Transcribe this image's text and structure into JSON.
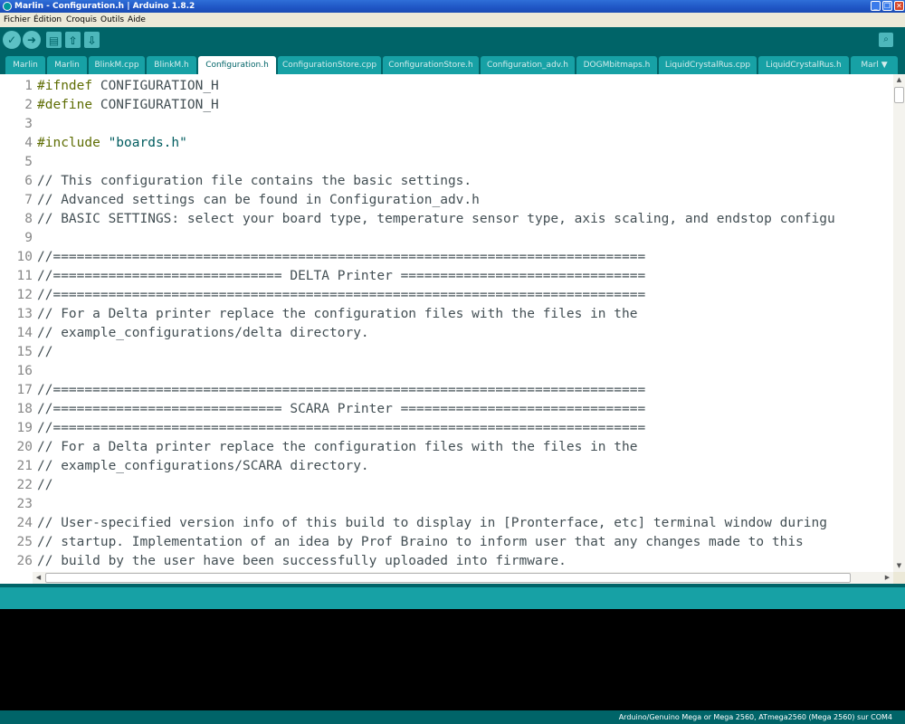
{
  "window": {
    "title": "Marlin - Configuration.h | Arduino 1.8.2",
    "minimize_glyph": "_",
    "maximize_glyph": "❐",
    "close_glyph": "✕"
  },
  "menu": [
    "Fichier",
    "Édition",
    "Croquis",
    "Outils",
    "Aide"
  ],
  "toolbar": {
    "verify_glyph": "✓",
    "upload_glyph": "➜",
    "new_glyph": "▤",
    "open_glyph": "⇧",
    "save_glyph": "⇩",
    "serial_glyph": "⌕"
  },
  "tabs": [
    "Marlin",
    "Marlin",
    "BlinkM.cpp",
    "BlinkM.h",
    "Configuration.h",
    "ConfigurationStore.cpp",
    "ConfigurationStore.h",
    "Configuration_adv.h",
    "DOGMbitmaps.h",
    "LiquidCrystalRus.cpp",
    "LiquidCrystalRus.h",
    "Marl ▼"
  ],
  "active_tab": "Configuration.h",
  "line_numbers": [
    "1",
    "2",
    "3",
    "4",
    "5",
    "6",
    "7",
    "8",
    "9",
    "10",
    "11",
    "12",
    "13",
    "14",
    "15",
    "16",
    "17",
    "18",
    "19",
    "20",
    "21",
    "22",
    "23",
    "24",
    "25",
    "26"
  ],
  "code": {
    "l1_kw": "#ifndef",
    "l1_rest": " CONFIGURATION_H",
    "l2_kw": "#define",
    "l2_rest": " CONFIGURATION_H",
    "l4_kw": "#include",
    "l4_str": " \"boards.h\"",
    "l6": "// This configuration file contains the basic settings.",
    "l7": "// Advanced settings can be found in Configuration_adv.h",
    "l8": "// BASIC SETTINGS: select your board type, temperature sensor type, axis scaling, and endstop configu",
    "l10": "//===========================================================================",
    "l11": "//============================= DELTA Printer ===============================",
    "l12": "//===========================================================================",
    "l13": "// For a Delta printer replace the configuration files with the files in the",
    "l14": "// example_configurations/delta directory.",
    "l15": "//",
    "l17": "//===========================================================================",
    "l18": "//============================= SCARA Printer ===============================",
    "l19": "//===========================================================================",
    "l20": "// For a Delta printer replace the configuration files with the files in the",
    "l21": "// example_configurations/SCARA directory.",
    "l22": "//",
    "l24": "// User-specified version info of this build to display in [Pronterface, etc] terminal window during",
    "l25": "// startup. Implementation of an idea by Prof Braino to inform user that any changes made to this",
    "l26": "// build by the user have been successfully uploaded into firmware."
  },
  "scroll": {
    "up": "▲",
    "down": "▼",
    "left": "◀",
    "right": "▶"
  },
  "status": "Arduino/Genuino Mega or Mega 2560, ATmega2560 (Mega 2560) sur COM4"
}
